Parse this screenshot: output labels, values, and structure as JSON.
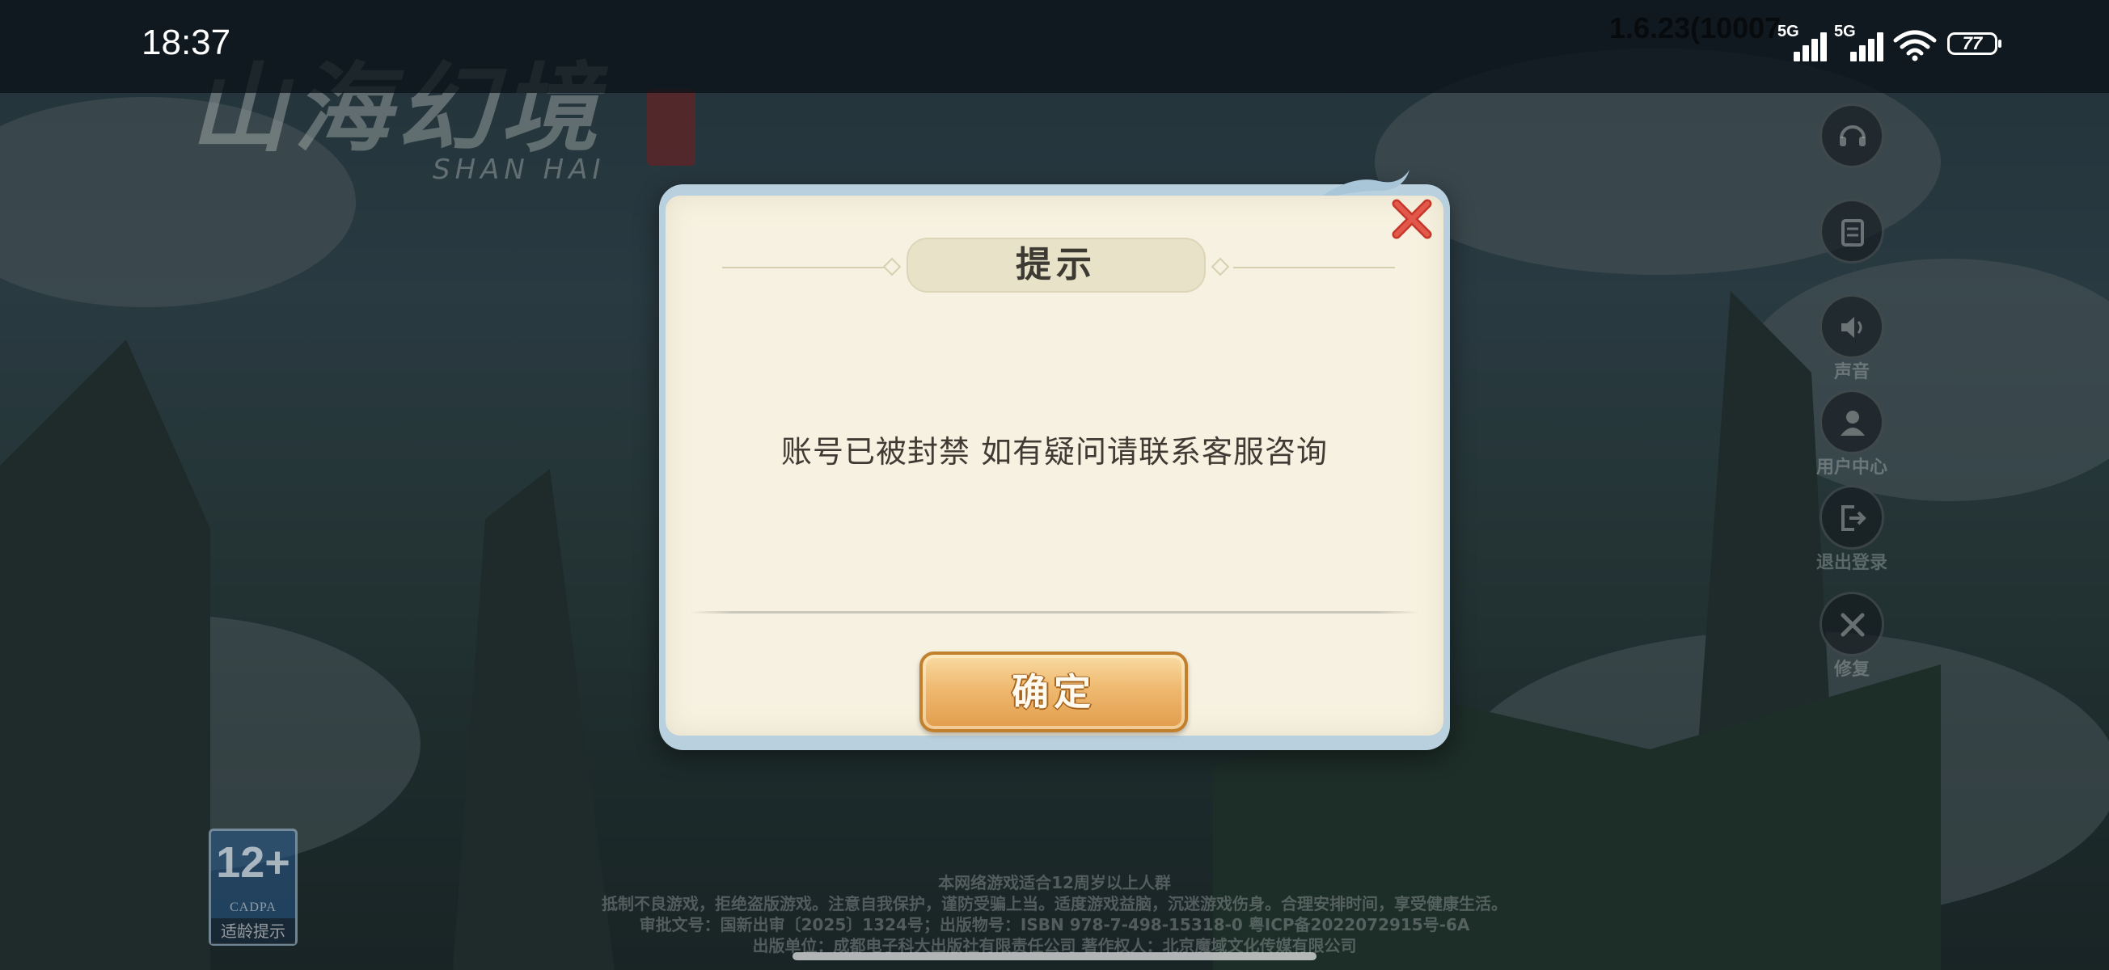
{
  "status_bar": {
    "time": "18:37",
    "version": "1.6.23(10007",
    "network_1": "5G",
    "network_2": "5G",
    "battery": "77"
  },
  "game": {
    "logo_text": "山海幻境",
    "logo_subtitle": "SHAN HAI"
  },
  "side_menu": {
    "items": [
      {
        "label": "",
        "icon": "headset-icon"
      },
      {
        "label": "",
        "icon": "notice-icon"
      },
      {
        "label": "声音",
        "icon": "sound-icon"
      },
      {
        "label": "用户中心",
        "icon": "user-icon"
      },
      {
        "label": "退出登录",
        "icon": "logout-icon"
      },
      {
        "label": "修复",
        "icon": "repair-icon"
      }
    ]
  },
  "age_rating": {
    "number": "12+",
    "org": "CADPA",
    "label": "适龄提示"
  },
  "footer": {
    "line1": "本网络游戏适合12周岁以上人群",
    "line2": "抵制不良游戏，拒绝盗版游戏。注意自我保护，谨防受骗上当。适度游戏益脑，沉迷游戏伤身。合理安排时间，享受健康生活。",
    "line3": "审批文号：国新出审〔2025〕1324号；出版物号：ISBN 978-7-498-15318-0   粤ICP备2022072915号-6A",
    "line4": "出版单位：成都电子科大出版社有限责任公司  著作权人：北京魔域文化传媒有限公司"
  },
  "dialog": {
    "title": "提示",
    "message": "账号已被封禁 如有疑问请联系客服咨询",
    "confirm_label": "确定"
  },
  "colors": {
    "dialog_paper": "#f6f1e0",
    "dialog_frame": "#b9d0df",
    "confirm_gold": "#efb970",
    "close_red": "#d64b3a"
  }
}
